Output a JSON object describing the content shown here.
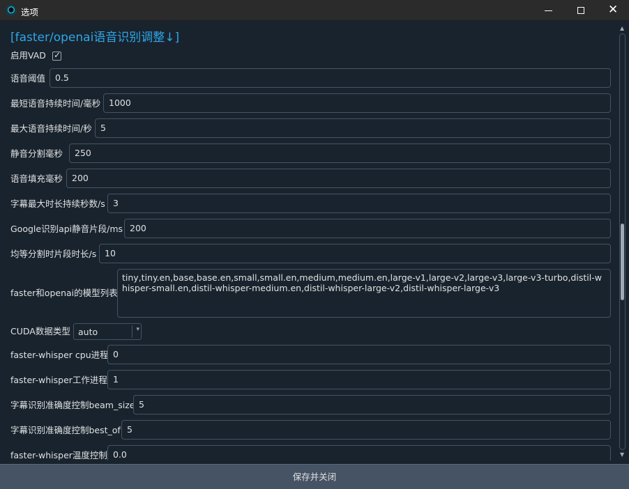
{
  "window": {
    "title": "选项",
    "minimize_icon": "minimize-icon",
    "maximize_icon": "maximize-icon",
    "close_icon": "close-icon",
    "close_glyph": "✕"
  },
  "section": {
    "title": "[faster/openai语音识别调整↓]"
  },
  "vad": {
    "label": "启用VAD",
    "checked": true,
    "check_glyph": "✓"
  },
  "fields": {
    "speech_threshold": {
      "label": "语音阈值",
      "value": "0.5"
    },
    "min_speech_ms": {
      "label": "最短语音持续时间/毫秒",
      "value": "1000"
    },
    "max_speech_s": {
      "label": "最大语音持续时间/秒",
      "value": "5"
    },
    "silence_split_ms": {
      "label": "静音分割毫秒",
      "value": "250"
    },
    "speech_pad_ms": {
      "label": "语音填充毫秒",
      "value": "200"
    },
    "subtitle_max_s": {
      "label": "字幕最大时长持续秒数/s",
      "value": "3"
    },
    "google_silence_ms": {
      "label": "Google识别api静音片段/ms",
      "value": "200"
    },
    "equal_split_s": {
      "label": "均等分割时片段时长/s",
      "value": "10"
    },
    "model_list": {
      "label": "faster和openai的模型列表",
      "value": "tiny,tiny.en,base,base.en,small,small.en,medium,medium.en,large-v1,large-v2,large-v3,large-v3-turbo,distil-whisper-small.en,distil-whisper-medium.en,distil-whisper-large-v2,distil-whisper-large-v3"
    },
    "cuda_type": {
      "label": "CUDA数据类型",
      "value": "auto",
      "arrow": "▾"
    },
    "fw_cpu_workers": {
      "label": "faster-whisper cpu进程",
      "value": "0"
    },
    "fw_workers": {
      "label": "faster-whisper工作进程",
      "value": "1"
    },
    "beam_size": {
      "label": "字幕识别准确度控制beam_size",
      "value": "5"
    },
    "best_of": {
      "label": "字幕识别准确度控制best_of",
      "value": "5"
    },
    "temperature": {
      "label": "faster-whisper温度控制",
      "value": "0.0"
    }
  },
  "scrollbar": {
    "up_glyph": "▲",
    "down_glyph": "▼",
    "position": 0.45
  },
  "footer": {
    "save_label": "保存并关闭"
  },
  "colors": {
    "background": "#19232d",
    "titlebar": "#2b2b2b",
    "accent": "#2ea6e8",
    "border": "#455364",
    "text": "#dfe1e2",
    "button": "#455364"
  }
}
